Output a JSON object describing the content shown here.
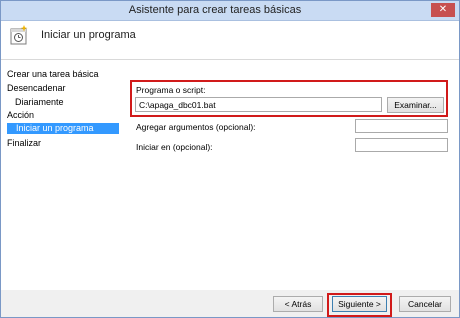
{
  "window": {
    "title": "Asistente para crear tareas básicas",
    "close_glyph": "✕"
  },
  "header": {
    "title": "Iniciar un programa",
    "icon": "task-scheduler-icon"
  },
  "sidebar": {
    "items": [
      {
        "label": "Crear una tarea básica"
      },
      {
        "label": "Desencadenar"
      },
      {
        "label": "Diariamente"
      },
      {
        "label": "Acción"
      },
      {
        "label": "Iniciar un programa",
        "selected": true
      },
      {
        "label": "Finalizar"
      }
    ]
  },
  "form": {
    "program_label": "Programa o script:",
    "program_value": "C:\\apaga_dbc01.bat",
    "browse_label": "Examinar...",
    "args_label": "Agregar argumentos (opcional):",
    "args_value": "",
    "start_label": "Iniciar en (opcional):",
    "start_value": ""
  },
  "footer": {
    "back_label": "< Atrás",
    "next_label": "Siguiente >",
    "cancel_label": "Cancelar"
  },
  "colors": {
    "highlight": "#d11a1a",
    "selection": "#3399ff",
    "titlebar": "#c9dbf3"
  }
}
